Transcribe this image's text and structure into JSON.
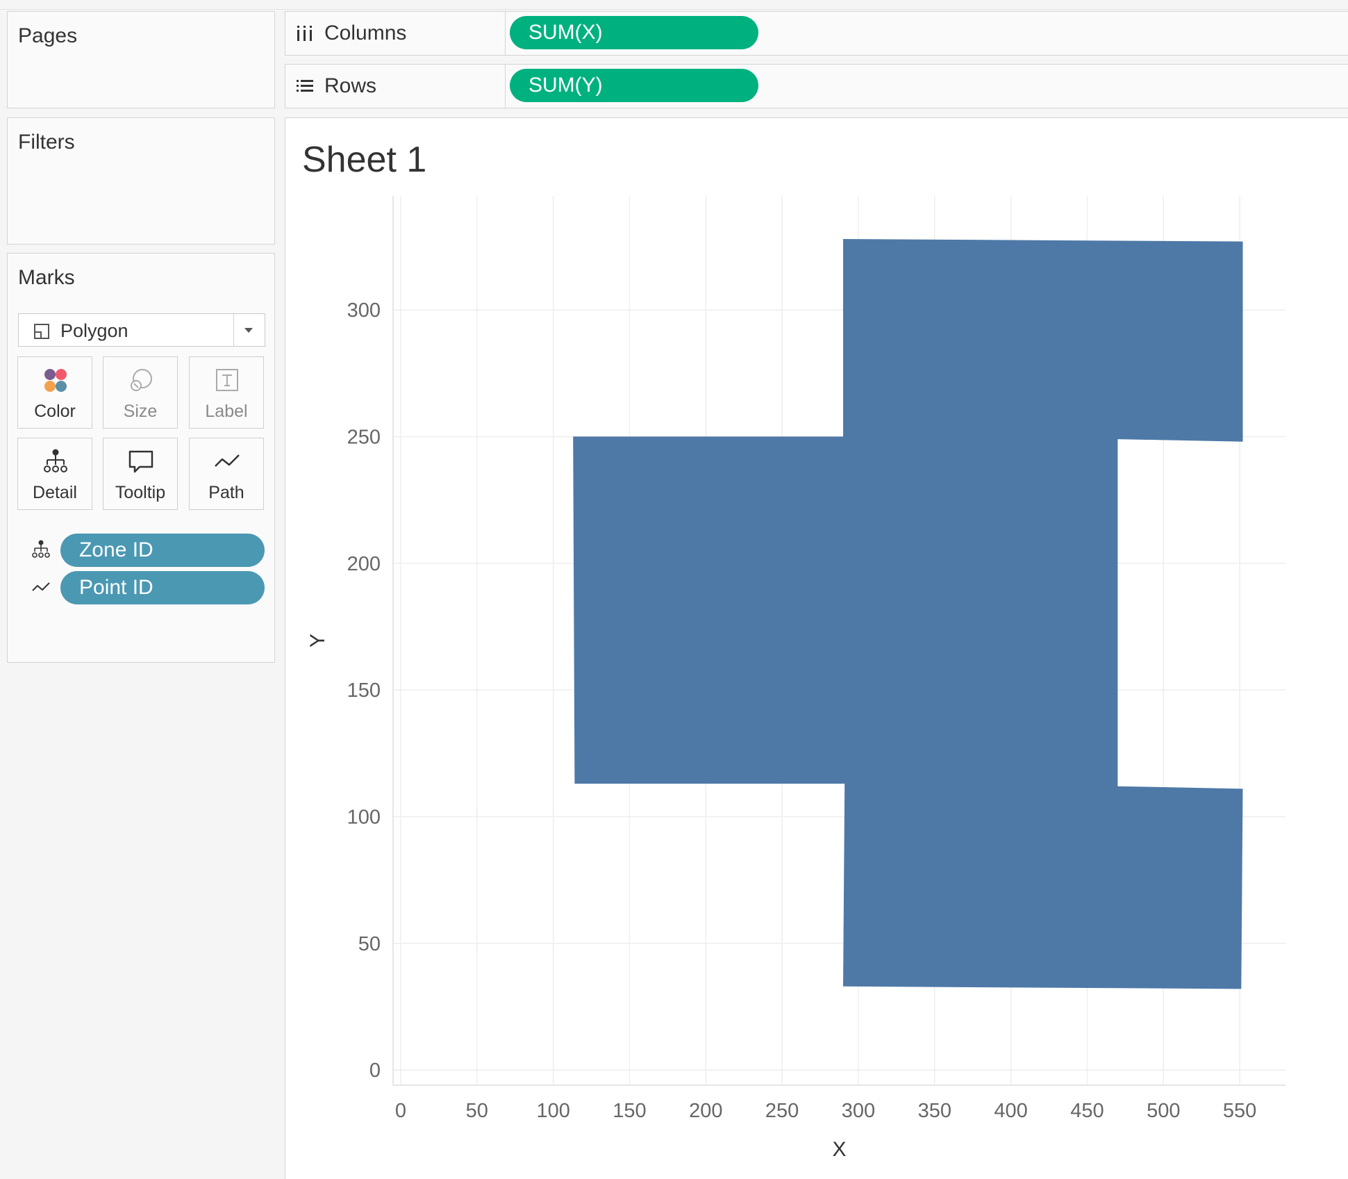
{
  "panels": {
    "pages_title": "Pages",
    "filters_title": "Filters",
    "marks_title": "Marks"
  },
  "marks": {
    "mark_type": "Polygon",
    "buttons": {
      "color": "Color",
      "size": "Size",
      "label": "Label",
      "detail": "Detail",
      "tooltip": "Tooltip",
      "path": "Path"
    },
    "fields": [
      {
        "role": "detail",
        "name": "Zone ID"
      },
      {
        "role": "path",
        "name": "Point ID"
      }
    ]
  },
  "shelves": {
    "columns_label": "Columns",
    "columns_pill": "SUM(X)",
    "rows_label": "Rows",
    "rows_pill": "SUM(Y)"
  },
  "sheet": {
    "title": "Sheet 1"
  },
  "colors": {
    "polygon_fill": "#4e79a7",
    "dimension_pill": "#4b98b3",
    "measure_pill": "#00b180"
  },
  "chart_data": {
    "type": "polygon",
    "xlabel": "X",
    "ylabel": "Y",
    "xlim": [
      -5,
      580
    ],
    "ylim": [
      -6,
      345
    ],
    "x_ticks": [
      0,
      50,
      100,
      150,
      200,
      250,
      300,
      350,
      400,
      450,
      500,
      550
    ],
    "y_ticks": [
      0,
      50,
      100,
      150,
      200,
      250,
      300
    ],
    "grid": true,
    "polygons": [
      {
        "zone": "1",
        "points": [
          [
            290,
            328
          ],
          [
            552,
            327
          ],
          [
            552,
            248
          ],
          [
            470,
            249
          ],
          [
            470,
            112
          ],
          [
            552,
            111
          ],
          [
            551,
            32
          ],
          [
            290,
            33
          ],
          [
            291,
            113
          ],
          [
            114,
            113
          ],
          [
            113,
            250
          ],
          [
            290,
            250
          ]
        ]
      }
    ]
  }
}
